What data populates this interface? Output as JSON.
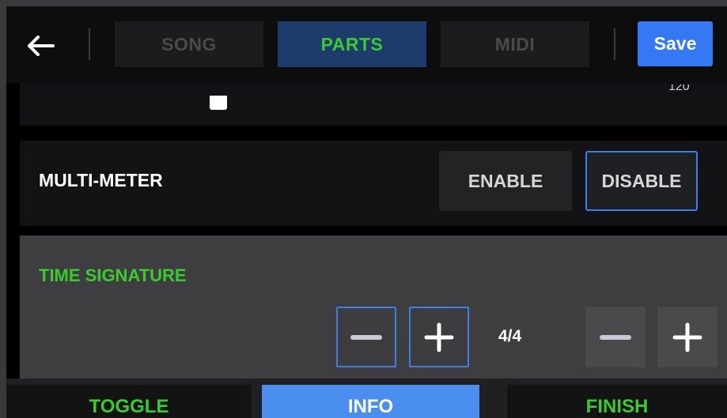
{
  "header": {
    "tabs": [
      {
        "label": "SONG",
        "active": false
      },
      {
        "label": "PARTS",
        "active": true
      },
      {
        "label": "MIDI",
        "active": false
      }
    ],
    "save_label": "Save"
  },
  "partial_row": {
    "value_text": "120"
  },
  "multi_meter": {
    "label": "MULTI-METER",
    "options": [
      "ENABLE",
      "DISABLE"
    ],
    "selected": "DISABLE"
  },
  "time_signature": {
    "label": "TIME SIGNATURE",
    "value": "4/4"
  },
  "bottom_bar": {
    "buttons": [
      {
        "label": "TOGGLE"
      },
      {
        "label": "INFO",
        "active": true
      },
      {
        "label": "FINISH"
      }
    ]
  },
  "colors": {
    "accent_green": "#39cc2e",
    "accent_blue": "#3478f6",
    "selected_border": "#3d7fe6"
  },
  "icons": {
    "back": "arrow-left-icon",
    "minus": "minus-icon",
    "plus": "plus-icon"
  }
}
